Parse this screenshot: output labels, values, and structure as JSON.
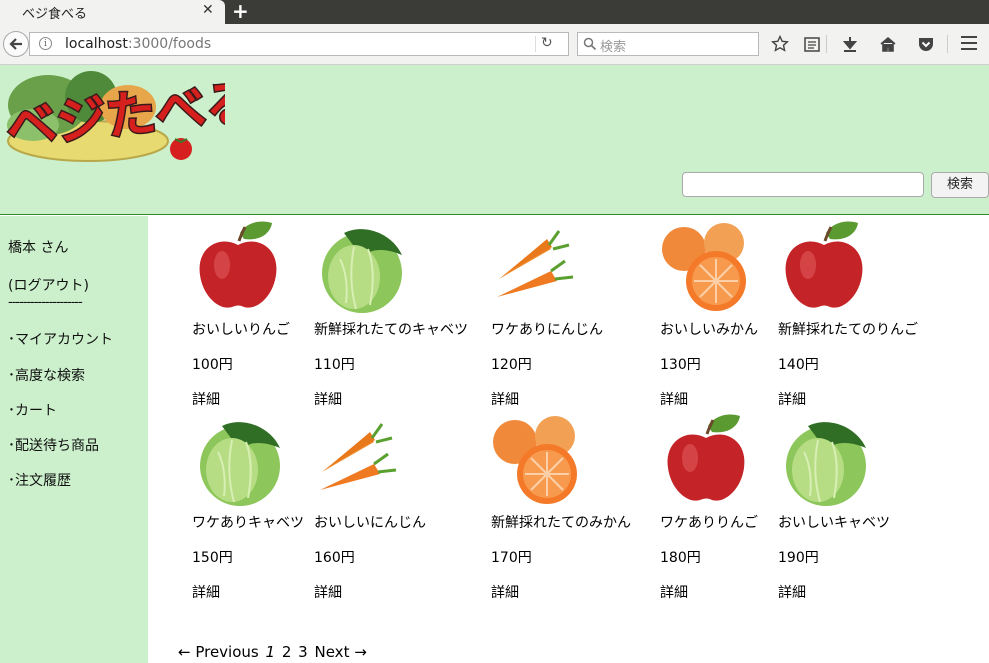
{
  "browser": {
    "tab_title": "ベジ食べる",
    "url_host": "localhost",
    "url_path": ":3000/foods",
    "search_placeholder": "検索"
  },
  "site": {
    "logo_text": "ベジたべる",
    "search_button": "検索"
  },
  "sidebar": {
    "user": "橋本 さん",
    "logout": "(ログアウト)",
    "divider": "--------------------",
    "items": [
      "･マイアカウント",
      "･高度な検索",
      "･カート",
      "･配送待ち商品",
      "･注文履歴"
    ]
  },
  "products": [
    {
      "name": "おいしいりんご",
      "price": "100円",
      "detail": "詳細",
      "image": "apple"
    },
    {
      "name": "新鮮採れたてのキャベツ",
      "price": "110円",
      "detail": "詳細",
      "image": "cabbage"
    },
    {
      "name": "ワケありにんじん",
      "price": "120円",
      "detail": "詳細",
      "image": "carrot"
    },
    {
      "name": "おいしいみかん",
      "price": "130円",
      "detail": "詳細",
      "image": "orange"
    },
    {
      "name": "新鮮採れたてのりんご",
      "price": "140円",
      "detail": "詳細",
      "image": "apple"
    },
    {
      "name": "ワケありキャベツ",
      "price": "150円",
      "detail": "詳細",
      "image": "cabbage"
    },
    {
      "name": "おいしいにんじん",
      "price": "160円",
      "detail": "詳細",
      "image": "carrot"
    },
    {
      "name": "新鮮採れたてのみかん",
      "price": "170円",
      "detail": "詳細",
      "image": "orange"
    },
    {
      "name": "ワケありりんご",
      "price": "180円",
      "detail": "詳細",
      "image": "apple"
    },
    {
      "name": "おいしいキャベツ",
      "price": "190円",
      "detail": "詳細",
      "image": "cabbage"
    }
  ],
  "pagination": {
    "previous": "← Previous",
    "pages": [
      "1",
      "2",
      "3"
    ],
    "current": "1",
    "next": "Next →"
  }
}
